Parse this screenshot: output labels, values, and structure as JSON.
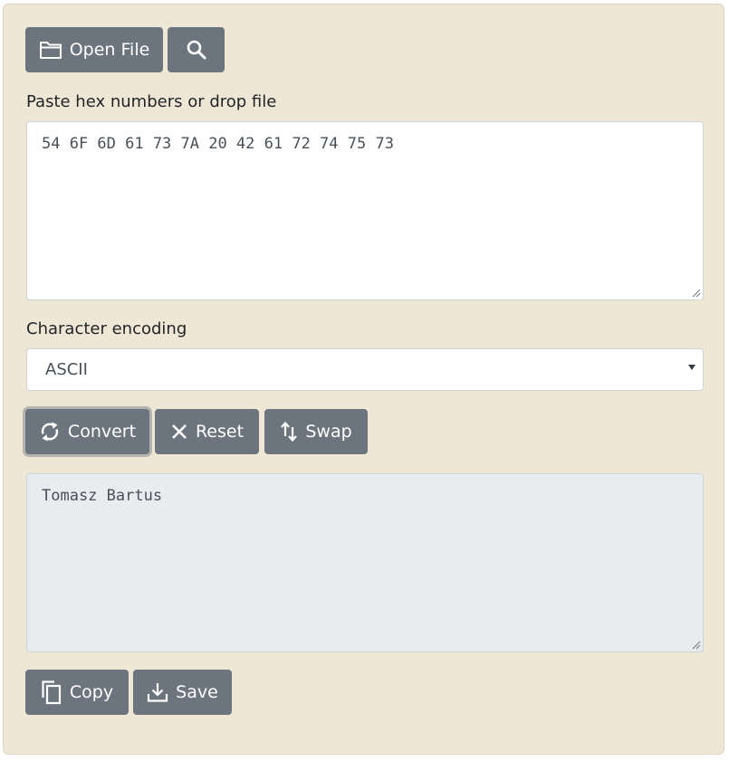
{
  "toolbar": {
    "open_file_label": "Open File",
    "search_icon": "search-icon"
  },
  "input": {
    "label": "Paste hex numbers or drop file",
    "value": "54 6F 6D 61 73 7A 20 42 61 72 74 75 73"
  },
  "encoding": {
    "label": "Character encoding",
    "selected": "ASCII"
  },
  "actions": {
    "convert_label": "Convert",
    "reset_label": "Reset",
    "swap_label": "Swap"
  },
  "output": {
    "value": "Tomasz Bartus"
  },
  "output_actions": {
    "copy_label": "Copy",
    "save_label": "Save"
  },
  "colors": {
    "panel_background": "#efe7d5",
    "button": "#6c757d",
    "output_background": "#e9ecef"
  }
}
